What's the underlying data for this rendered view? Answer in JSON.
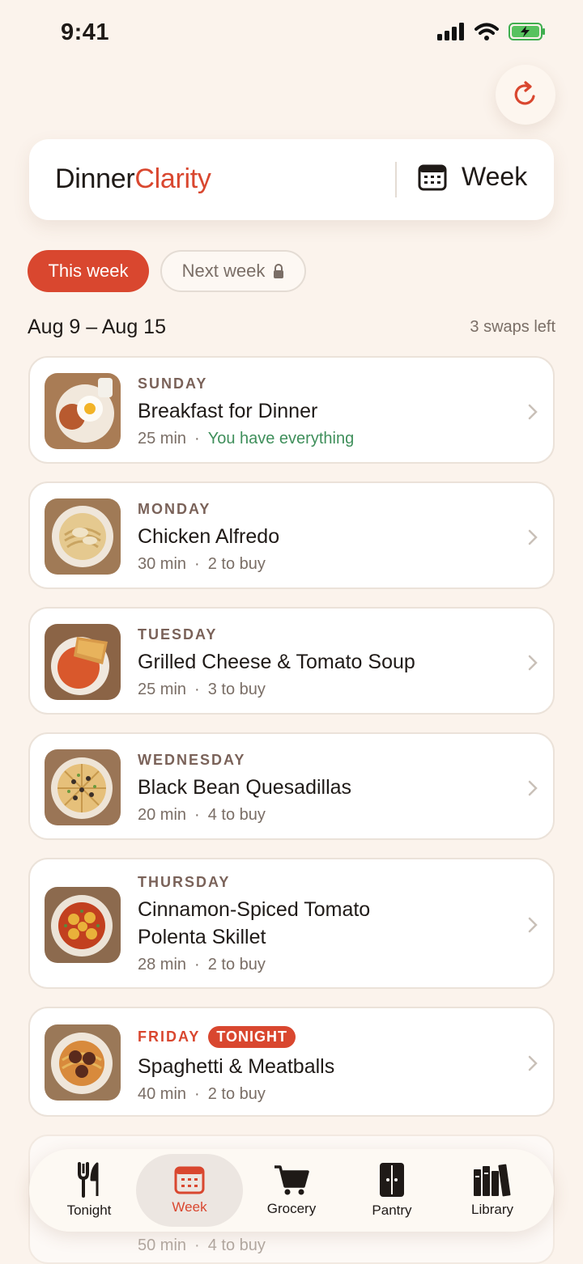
{
  "status_bar": {
    "time": "9:41"
  },
  "header": {
    "brand_part1": "Dinner",
    "brand_part2": "Clarity",
    "view_label": "Week"
  },
  "week_tabs": {
    "this_week": "This week",
    "next_week": "Next week"
  },
  "range": {
    "dates": "Aug 9 – Aug 15",
    "swaps_left": "3 swaps left"
  },
  "meals": [
    {
      "day": "SUNDAY",
      "name": "Breakfast for Dinner",
      "time": "25 min",
      "status": "You have everything"
    },
    {
      "day": "MONDAY",
      "name": "Chicken Alfredo",
      "time": "30 min",
      "status": "2 to buy"
    },
    {
      "day": "TUESDAY",
      "name": "Grilled Cheese & Tomato Soup",
      "time": "25 min",
      "status": "3 to buy"
    },
    {
      "day": "WEDNESDAY",
      "name": "Black Bean Quesadillas",
      "time": "20 min",
      "status": "4 to buy"
    },
    {
      "day": "THURSDAY",
      "name": "Cinnamon-Spiced Tomato Polenta Skillet",
      "time": "28 min",
      "status": "2 to buy"
    },
    {
      "day": "FRIDAY",
      "badge": "TONIGHT",
      "name": "Spaghetti & Meatballs",
      "time": "40 min",
      "status": "2 to buy"
    },
    {
      "time": "50 min",
      "status": "4 to buy"
    }
  ],
  "tabbar": {
    "tonight": "Tonight",
    "week": "Week",
    "grocery": "Grocery",
    "pantry": "Pantry",
    "library": "Library"
  },
  "colors": {
    "accent": "#d9472f",
    "success": "#3f8f5b",
    "background": "#fbf3ec"
  },
  "icons": [
    "refresh-icon",
    "calendar-icon",
    "lock-icon",
    "chevron-right-icon",
    "fork-knife-icon",
    "cart-icon",
    "pantry-icon",
    "books-icon"
  ]
}
